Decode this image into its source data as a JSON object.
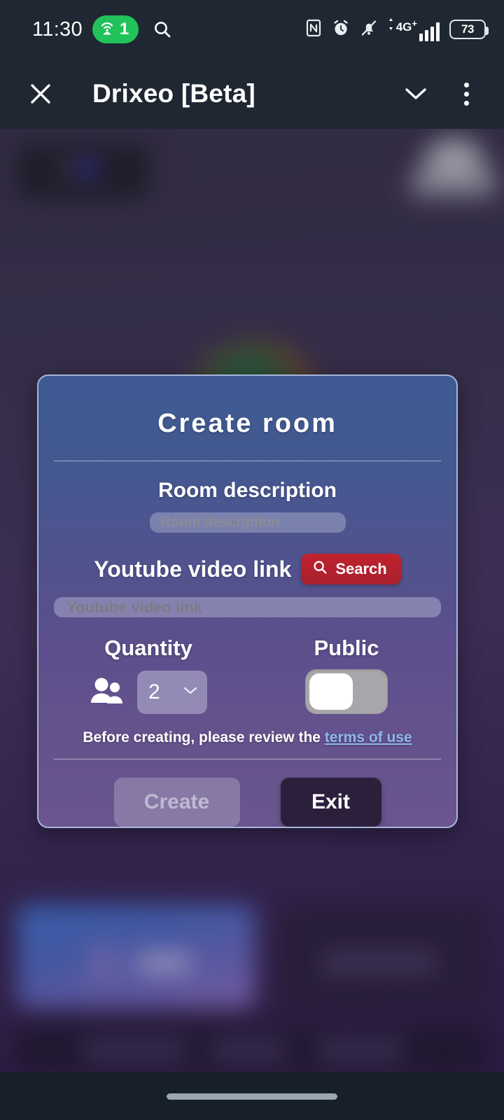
{
  "statusbar": {
    "time": "11:30",
    "hotspot_count": "1",
    "hotspot_icon": "wifi-hotspot-icon",
    "search_icon": "search-icon",
    "nfc_icon": "nfc-icon",
    "alarm_icon": "alarm-clock-icon",
    "mute_icon": "bell-muted-icon",
    "network_label": "4G",
    "network_plus": "+",
    "signal_icon": "signal-bars-icon",
    "battery_level": "73"
  },
  "appbar": {
    "close_icon": "close-icon",
    "title": "Drixeo [Beta]",
    "chevron_icon": "chevron-down-icon",
    "overflow_icon": "more-vertical-icon"
  },
  "dialog": {
    "title": "Create room",
    "room_description": {
      "label": "Room description",
      "placeholder": "Room description",
      "value": ""
    },
    "youtube": {
      "label": "Youtube video link",
      "search_button": "Search",
      "search_icon": "search-icon",
      "placeholder": "Youtube video link",
      "value": ""
    },
    "quantity": {
      "label": "Quantity",
      "people_icon": "people-icon",
      "value": "2",
      "chevron_icon": "chevron-down-icon"
    },
    "public": {
      "label": "Public",
      "state": "off"
    },
    "terms": {
      "text": "Before creating, please review the ",
      "link": "terms of use"
    },
    "buttons": {
      "create": "Create",
      "create_disabled": true,
      "exit": "Exit"
    }
  },
  "navbar": {
    "gesture_pill": "home-gesture-pill"
  },
  "colors": {
    "status_bg": "#1e2732",
    "hotspot_green": "#21c25a",
    "dialog_top": "#3f5a95",
    "dialog_bottom": "#6a558e",
    "dialog_border": "#a5b6d8",
    "search_red": "#b8212e",
    "link_blue": "#8fb8ee",
    "exit_dark": "#2c1f3c"
  }
}
